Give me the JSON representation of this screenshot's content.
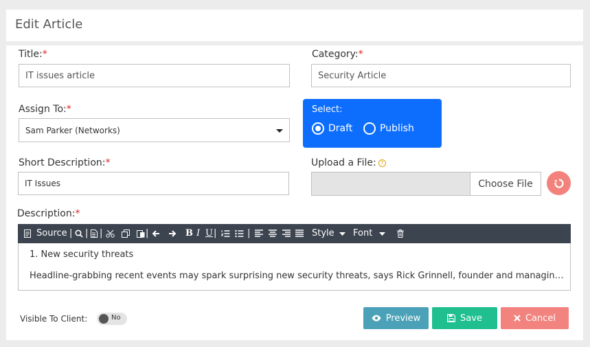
{
  "header": {
    "title": "Edit Article"
  },
  "form": {
    "title_label": "Title:",
    "title_value": "IT issues article",
    "category_label": "Category:",
    "category_value": "Security Article",
    "assign_label": "Assign To:",
    "assign_value": "Sam Parker (Networks)",
    "select_label": "Select:",
    "radio_draft": "Draft",
    "radio_publish": "Publish",
    "radio_selected": "Draft",
    "short_desc_label": "Short Description:",
    "short_desc_value": "IT Issues",
    "upload_label": "Upload a File:",
    "choose_file": "Choose File",
    "description_label": "Description:",
    "required_mark": "*"
  },
  "toolbar": {
    "source": "Source",
    "style": "Style",
    "font": "Font",
    "icons": [
      "source-icon",
      "search-icon",
      "new-page-icon",
      "cut-icon",
      "copy-icon",
      "paste-icon",
      "undo-icon",
      "redo-icon",
      "bold-icon",
      "italic-icon",
      "underline-icon",
      "numbered-list-icon",
      "bulleted-list-icon",
      "align-left-icon",
      "align-center-icon",
      "align-right-icon",
      "justify-icon",
      "trash-icon"
    ]
  },
  "editor": {
    "line1": "1. New security threats",
    "line2": "Headline-grabbing recent events may spark surprising new security threats, says Rick Grinnell, founder and managing director at Glasswing Ventures. Here are the threats to watch"
  },
  "footer": {
    "visible_label": "Visible To Client:",
    "toggle_text": "No",
    "preview": "Preview",
    "save": "Save",
    "cancel": "Cancel"
  },
  "colors": {
    "radio_bg": "#0d6efd",
    "preview": "#4ba2b8",
    "save": "#1fbf8f",
    "cancel": "#f3837e",
    "reset": "#f3827c",
    "toolbar": "#3c4450"
  }
}
